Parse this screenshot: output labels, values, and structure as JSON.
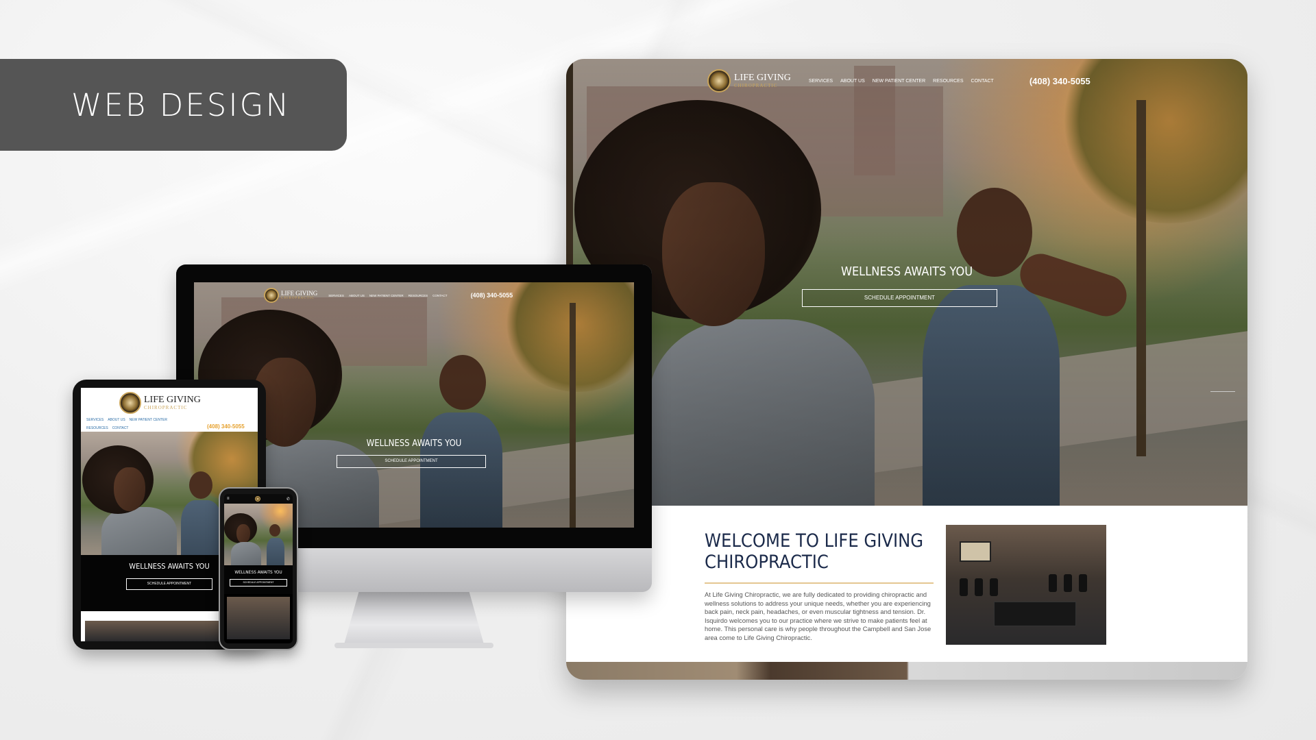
{
  "banner": {
    "label": "WEB DESIGN"
  },
  "site": {
    "logo_title": "LIFE GIVING",
    "logo_subtitle": "CHIROPRACTIC",
    "nav": [
      "SERVICES",
      "ABOUT US",
      "NEW PATIENT CENTER",
      "RESOURCES",
      "CONTACT"
    ],
    "phone": "(408) 340-5055",
    "hero_title": "WELLNESS AWAITS YOU",
    "hero_button": "SCHEDULE APPOINTMENT",
    "welcome_title": "WELCOME TO LIFE GIVING CHIROPRACTIC",
    "welcome_text": "At Life Giving Chiropractic, we are fully dedicated to providing chiropractic and wellness solutions to address your unique needs, whether you are experiencing back pain, neck pain, headaches, or even muscular tightness and tension. Dr. Isquirdo welcomes you to our practice where we strive to make patients feel at home. This personal care is why people throughout the Campbell and San Jose area come to Life Giving Chiropractic."
  },
  "colors": {
    "banner_bg": "#555555",
    "accent_gold": "#c9a45a",
    "welcome_navy": "#1b2a4a",
    "phone_orange": "#e6a12e"
  },
  "icons": [
    "dropdown-caret-icon",
    "hamburger-menu-icon",
    "phone-icon",
    "logo-mark-icon"
  ]
}
